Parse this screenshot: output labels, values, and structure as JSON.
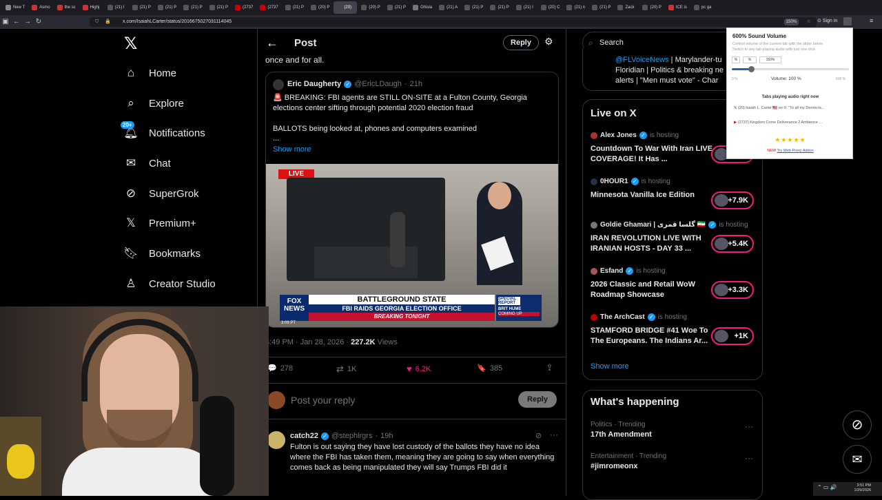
{
  "browser": {
    "tabs": [
      "New T",
      "Asmo",
      "the sc",
      "Highj",
      "(21) I",
      "(21) P",
      "(21) P",
      "(21) P",
      "(21) P",
      "(2737",
      "(2737",
      "(21) P",
      "(20) P",
      "(20)",
      "(20) P",
      "(21) P",
      "Ghisla",
      "(21) A",
      "(21) P",
      "(21) P",
      "(21) I",
      "(20) C",
      "(21) n",
      "(21) P",
      "Zack",
      "(20) P",
      "ICE is",
      "pc ga"
    ],
    "active_tab_index": 13,
    "url": "x.com/IsaiahLCarter/status/2016675027031114045",
    "zoom": "150%",
    "sign_in": "Sign in"
  },
  "left_nav": {
    "items": [
      {
        "label": "Home",
        "icon": "home-icon"
      },
      {
        "label": "Explore",
        "icon": "search-icon"
      },
      {
        "label": "Notifications",
        "icon": "bell-icon",
        "badge": "20+"
      },
      {
        "label": "Chat",
        "icon": "mail-icon"
      },
      {
        "label": "SuperGrok",
        "icon": "grok-icon"
      },
      {
        "label": "Premium+",
        "icon": "x-logo-icon"
      },
      {
        "label": "Bookmarks",
        "icon": "bookmark-icon"
      },
      {
        "label": "Creator Studio",
        "icon": "creator-icon"
      }
    ]
  },
  "post": {
    "header_title": "Post",
    "reply_button": "Reply",
    "top_text": "once and for all.",
    "quote": {
      "name": "Eric Daugherty",
      "handle": "@EricLDaugh",
      "time": "21h",
      "line1": "🚨 BREAKING: FBI agents are STILL ON-SITE at a Fulton County, Georgia elections center sifting through potential 2020 election fraud",
      "line2": "BALLOTS being looked at, phones and computers examined",
      "ellipsis": "...",
      "show_more": "Show more",
      "image": {
        "live": "LIVE",
        "banner_top": "BATTLEGROUND STATE",
        "banner_mid": "FBI RAIDS GEORGIA ELECTION OFFICE",
        "banner_bottom": "BREAKING TONIGHT",
        "fox": "FOX NEWS",
        "time": "3:09 PT",
        "special": "SPECIAL REPORT",
        "brit": "BRIT HUME",
        "coming": "COMING UP"
      }
    },
    "timestamp": "3:49 PM · Jan 28, 2026 · ",
    "views_count": "227.2K",
    "views_label": " Views",
    "actions": {
      "replies": "278",
      "reposts": "1K",
      "likes": "6.2K",
      "bookmarks": "385"
    },
    "compose_placeholder": "Post your reply",
    "compose_button": "Reply"
  },
  "reply": {
    "name": "catch22",
    "handle": "@stephlrgrs",
    "time": "19h",
    "text": "Fulton is out saying they have lost custody of the ballots they have no idea where the FBI has taken them, meaning they are going to say when everything comes back as being manipulated they will say Trumps FBI did it"
  },
  "right": {
    "search_placeholder": "Search",
    "profile_card": {
      "mention": "@FLVoiceNews",
      "text1": " | Marylander-tu",
      "text2": "Floridian | Politics & breaking ne",
      "text3": "alerts | \"Men must vote\" - Char"
    },
    "live_title": "Live on X",
    "live_items": [
      {
        "host": "Alex Jones",
        "status": "is hosting",
        "title": "Countdown To War With Iran LIVE COVERAGE! It Has ...",
        "count": ""
      },
      {
        "host": "0HOUR1",
        "status": "is hosting",
        "title": "Minnesota Vanilla Ice Edition",
        "count": "+7.9K"
      },
      {
        "host": "Goldie Ghamari | گلسا قمری 🇮🇷",
        "status": "is hosting",
        "title": "IRAN REVOLUTION LIVE WITH IRANIAN HOSTS - DAY 33 ...",
        "count": "+5.4K"
      },
      {
        "host": "Esfand",
        "status": "is hosting",
        "title": "2026 Classic and Retail WoW Roadmap Showcase",
        "count": "+3.3K"
      },
      {
        "host": "The ArchCast",
        "status": "is hosting",
        "title": "STAMFORD BRIDGE #41 Woe To The Europeans. The Indians Ar...",
        "count": "+1K"
      }
    ],
    "show_more": "Show more",
    "happening_title": "What's happening",
    "trends": [
      {
        "category": "Politics · Trending",
        "name": "17th Amendment"
      },
      {
        "category": "Entertainment · Trending",
        "name": "#jimromeonx"
      }
    ]
  },
  "popup": {
    "title": "600% Sound Volume",
    "desc1": "Control volume of the current tab with the slider below",
    "desc2": "Switch to any tab playing audio with just one click",
    "btn1": "%",
    "btn2": "%",
    "btn3": "150%",
    "min": "0 %",
    "volume_label": "Volume: 100 %",
    "max": "600 %",
    "volume_percent": 100,
    "tabs_title": "Tabs playing audio right now",
    "tab1": "(20) Isaiah L. Carter 🇺🇸 on X: \"To all my Democra...",
    "tab2": "(2737) Kingdom Come Deliverance 2 Ambience ...",
    "stars": "★★★★★",
    "new_label": "NEW ",
    "proxy_link": "Try Web Proxy Addon"
  },
  "taskbar": {
    "time": "3:51 PM",
    "date": "1/29/2026"
  }
}
